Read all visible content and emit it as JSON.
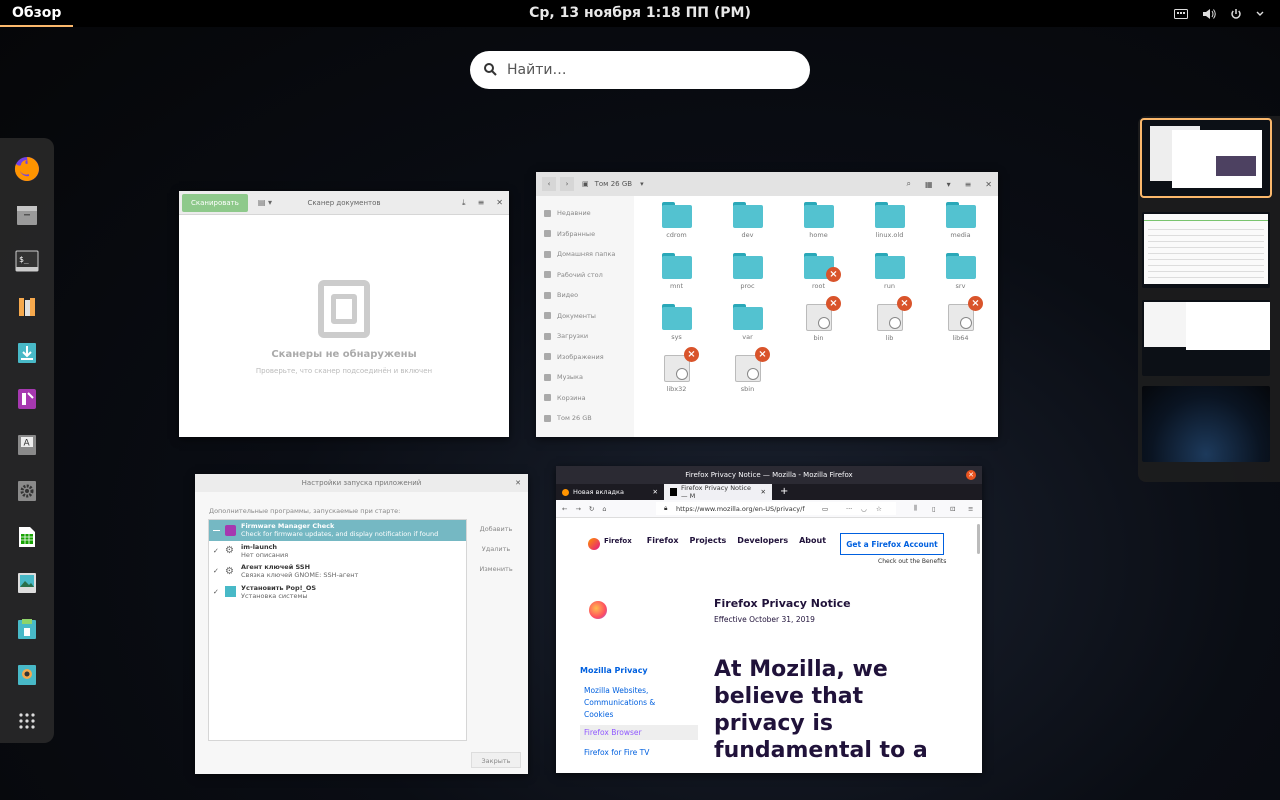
{
  "topbar": {
    "overview_label": "Обзор",
    "clock": "Ср, 13 ноября   1:18 ПП (PM)"
  },
  "search": {
    "placeholder": "Найти…"
  },
  "dock": {
    "items": [
      "firefox-icon",
      "files-icon",
      "terminal-icon",
      "library-icon",
      "download-icon",
      "popsicle-icon",
      "font-viewer-icon",
      "settings-icon",
      "spreadsheet-icon",
      "image-viewer-icon",
      "app-installer-icon",
      "color-picker-icon",
      "app-grid-icon"
    ]
  },
  "scanner": {
    "scan_button": "Сканировать",
    "title": "Сканер документов",
    "empty_title": "Сканеры не обнаружены",
    "empty_hint": "Проверьте, что сканер подсоединён и включен"
  },
  "files": {
    "location": "Том 26 GB",
    "sidebar": [
      "Недавние",
      "Избранные",
      "Домашняя папка",
      "Рабочий стол",
      "Видео",
      "Документы",
      "Загрузки",
      "Изображения",
      "Музыка",
      "Корзина",
      "Том 26 GB"
    ],
    "items": [
      {
        "name": "cdrom",
        "kind": "folder",
        "locked": false
      },
      {
        "name": "dev",
        "kind": "folder",
        "locked": false
      },
      {
        "name": "home",
        "kind": "folder",
        "locked": false
      },
      {
        "name": "linux.old",
        "kind": "folder",
        "locked": false
      },
      {
        "name": "media",
        "kind": "folder",
        "locked": false
      },
      {
        "name": "mnt",
        "kind": "folder",
        "locked": false
      },
      {
        "name": "proc",
        "kind": "folder",
        "locked": false
      },
      {
        "name": "root",
        "kind": "folder",
        "locked": true
      },
      {
        "name": "run",
        "kind": "folder",
        "locked": false
      },
      {
        "name": "srv",
        "kind": "folder",
        "locked": false
      },
      {
        "name": "sys",
        "kind": "folder",
        "locked": false
      },
      {
        "name": "var",
        "kind": "folder",
        "locked": false
      },
      {
        "name": "bin",
        "kind": "link",
        "locked": true
      },
      {
        "name": "lib",
        "kind": "link",
        "locked": true
      },
      {
        "name": "lib64",
        "kind": "link",
        "locked": true
      },
      {
        "name": "libx32",
        "kind": "link",
        "locked": true
      },
      {
        "name": "sbin",
        "kind": "link",
        "locked": true
      }
    ]
  },
  "startup": {
    "title": "Настройки запуска приложений",
    "subtitle": "Дополнительные программы, запускаемые при старте:",
    "rows": [
      {
        "name": "Firmware Manager Check",
        "desc": "Check for firmware updates, and display notification if found"
      },
      {
        "name": "im-launch",
        "desc": "Нет описания"
      },
      {
        "name": "Агент ключей SSH",
        "desc": "Связка ключей GNOME: SSH-агент"
      },
      {
        "name": "Установить Pop!_OS",
        "desc": "Установка системы"
      }
    ],
    "add_label": "Добавить",
    "remove_label": "Удалить",
    "edit_label": "Изменить",
    "close_label": "Закрыть"
  },
  "firefox": {
    "title": "Firefox Privacy Notice — Mozilla - Mozilla Firefox",
    "tab1": "Новая вкладка",
    "tab2": "Firefox Privacy Notice — M",
    "url": "https://www.mozilla.org/en-US/privacy/f",
    "nav": [
      "Firefox",
      "Projects",
      "Developers",
      "About"
    ],
    "account_btn": "Get a Firefox Account",
    "benefits": "Check out the Benefits",
    "heading": "Firefox Privacy Notice",
    "effective": "Effective October 31, 2019",
    "big_text": "At Mozilla, we believe that privacy is fundamental to a",
    "side_title": "Mozilla Privacy",
    "side_links": [
      "Mozilla Websites, Communications & Cookies",
      "Firefox Browser",
      "Firefox for Fire TV"
    ]
  },
  "colors": {
    "accent": "#fbb86c",
    "folder": "#53c2d0",
    "selection": "#75b8c3",
    "mozilla_blue": "#0060df"
  }
}
